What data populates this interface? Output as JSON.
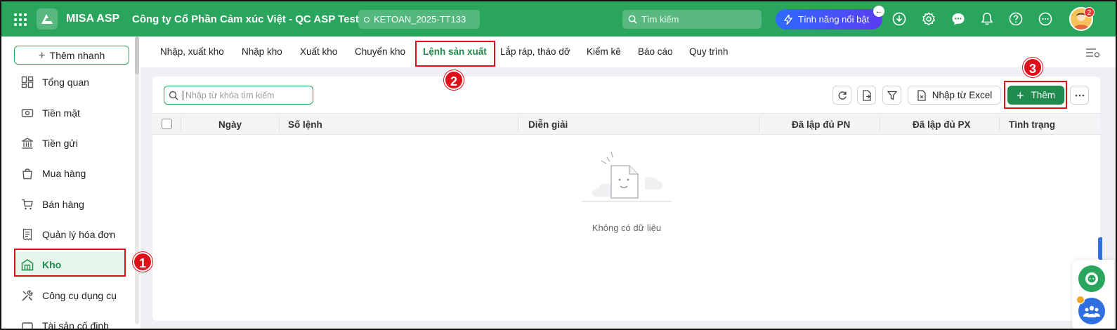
{
  "header": {
    "app_name": "MISA ASP",
    "company": "Công ty Cổ Phần Cảm xúc Việt - QC ASP Test",
    "database": "KETOAN_2025-TT133",
    "search_placeholder": "Tìm kiếm",
    "feature_button": "Tính năng nổi bật",
    "notification_count": "2",
    "icons": [
      "apps-grid-icon",
      "download-icon",
      "settings-icon",
      "chat-icon",
      "bell-icon",
      "help-icon",
      "more-icon"
    ],
    "brand_color": "#2aa55d"
  },
  "sidebar": {
    "quick_add": "Thêm nhanh",
    "items": [
      {
        "label": "Tổng quan",
        "icon": "dashboard-icon"
      },
      {
        "label": "Tiền mặt",
        "icon": "cash-icon"
      },
      {
        "label": "Tiền gửi",
        "icon": "bank-icon"
      },
      {
        "label": "Mua hàng",
        "icon": "shopping-bag-icon"
      },
      {
        "label": "Bán hàng",
        "icon": "cart-icon"
      },
      {
        "label": "Quản lý hóa đơn",
        "icon": "invoice-icon"
      },
      {
        "label": "Kho",
        "icon": "warehouse-icon",
        "active": true
      },
      {
        "label": "Công cụ dụng cụ",
        "icon": "tools-icon"
      },
      {
        "label": "Tài sản cố định",
        "icon": "asset-icon"
      }
    ]
  },
  "tabs": [
    {
      "label": "Nhập, xuất kho"
    },
    {
      "label": "Nhập kho"
    },
    {
      "label": "Xuất kho"
    },
    {
      "label": "Chuyển kho"
    },
    {
      "label": "Lệnh sản xuất",
      "active": true
    },
    {
      "label": "Lắp ráp, tháo dỡ"
    },
    {
      "label": "Kiểm kê"
    },
    {
      "label": "Báo cáo"
    },
    {
      "label": "Quy trình"
    }
  ],
  "toolbar": {
    "search_placeholder": "Nhập từ khóa tìm kiếm",
    "import_excel": "Nhập từ Excel",
    "add": "Thêm"
  },
  "table": {
    "columns": [
      "Ngày",
      "Số lệnh",
      "Diễn giải",
      "Đã lập đủ PN",
      "Đã lập đủ PX",
      "Tình trạng"
    ],
    "rows": [],
    "empty_text": "Không có dữ liệu"
  },
  "annotations": {
    "step1": "1",
    "step2": "2",
    "step3": "3",
    "color": "#e0101a"
  }
}
